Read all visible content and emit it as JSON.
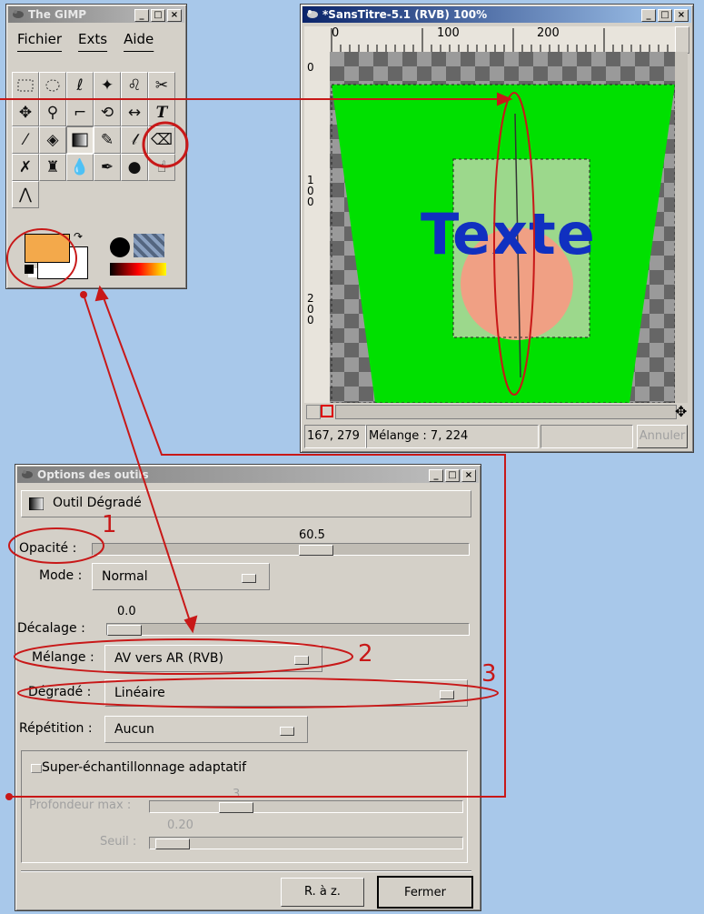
{
  "toolbox": {
    "title": "The GIMP",
    "menu": [
      "Fichier",
      "Exts",
      "Aide"
    ],
    "tools": [
      "rect-select",
      "ellipse-select",
      "lasso",
      "fuzzy-select",
      "bezier",
      "scissors",
      "move",
      "magnify",
      "crop",
      "transform",
      "flip",
      "text",
      "color-picker",
      "bucket-fill",
      "blend",
      "pencil",
      "paintbrush",
      "eraser",
      "airbrush",
      "clone",
      "convolve",
      "ink",
      "dodge",
      "smudge",
      "measure"
    ],
    "fg_color": "#f3a94b",
    "bg_color": "#ffffff"
  },
  "image_window": {
    "title": "*SansTitre-5.1 (RVB) 100%",
    "ruler_top": [
      "0",
      "100",
      "200"
    ],
    "ruler_left": [
      "0",
      "1",
      "0",
      "0",
      "2",
      "0",
      "0"
    ],
    "canvas_text": "Texte",
    "coords": "167, 279",
    "status": "Mélange : 7, 224",
    "cancel_label": "Annuler"
  },
  "tool_options": {
    "title": "Options des outils",
    "tool_name": "Outil Dégradé",
    "opacity": {
      "label": "Opacité :",
      "value": "60.5",
      "fraction": 0.605
    },
    "mode": {
      "label": "Mode :",
      "value": "Normal"
    },
    "offset": {
      "label": "Décalage :",
      "value": "0.0",
      "fraction": 0.0
    },
    "blend": {
      "label": "Mélange :",
      "value": "AV vers AR (RVB)"
    },
    "gradient": {
      "label": "Dégradé :",
      "value": "Linéaire"
    },
    "repeat": {
      "label": "Répétition :",
      "value": "Aucun"
    },
    "supersample": {
      "label": "Super-échantillonnage adaptatif",
      "checked": false
    },
    "max_depth": {
      "label": "Profondeur max :",
      "value": "3"
    },
    "threshold": {
      "label": "Seuil :",
      "value": "0.20"
    },
    "reset_label": "R. à z.",
    "close_label": "Fermer"
  },
  "annotations": {
    "n1": "1",
    "n2": "2",
    "n3": "3"
  },
  "colors": {
    "accent_red": "#c81818",
    "canvas_green": "#00e000",
    "text_blue": "#1030c0"
  }
}
